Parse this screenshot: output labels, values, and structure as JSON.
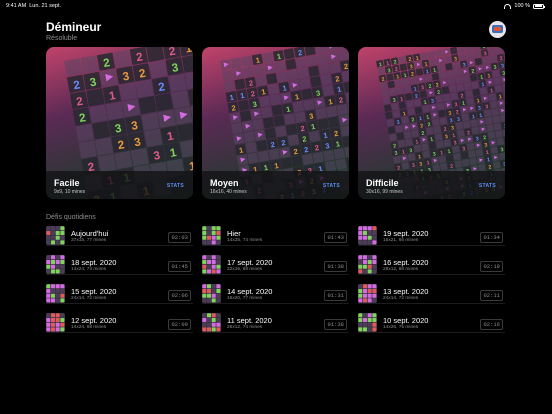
{
  "status": {
    "time": "9:41 AM",
    "date": "Lun. 21 sept.",
    "battery": "100 %"
  },
  "header": {
    "title": "Démineur",
    "subtitle": "Résoluble"
  },
  "icons": {
    "wifi": "wifi-icon",
    "battery": "battery-icon",
    "avatar": "profile-avatar"
  },
  "colors": {
    "accent": "#5b8ef2",
    "background": "#000000",
    "secondary_text": "#8e8e93"
  },
  "cards": [
    {
      "name": "Facile",
      "info": "9x9, 10 mines",
      "stats": "STATS"
    },
    {
      "name": "Moyen",
      "info": "16x16, 40 mines",
      "stats": "STATS"
    },
    {
      "name": "Difficile",
      "info": "30x16, 99 mines",
      "stats": "STATS"
    }
  ],
  "daily": {
    "title": "Défis quotidiens",
    "items": [
      {
        "name": "Aujourd'hui",
        "info": "37x15, 77 mines",
        "time": "02:03"
      },
      {
        "name": "Hier",
        "info": "14x25, 74 mines",
        "time": "01:43"
      },
      {
        "name": "19 sept. 2020",
        "info": "16x21, 66 mines",
        "time": "01:34"
      },
      {
        "name": "18 sept. 2020",
        "info": "14x24, 74 mines",
        "time": "01:45"
      },
      {
        "name": "17 sept. 2020",
        "info": "22x16, 68 mines",
        "time": "01:38"
      },
      {
        "name": "16 sept. 2020",
        "info": "28x12, 68 mines",
        "time": "02:19"
      },
      {
        "name": "15 sept. 2020",
        "info": "24x14, 72 mines",
        "time": "02:06"
      },
      {
        "name": "14 sept. 2020",
        "info": "16x20, 77 mines",
        "time": "01:31"
      },
      {
        "name": "13 sept. 2020",
        "info": "24x14, 72 mines",
        "time": "02:11"
      },
      {
        "name": "12 sept. 2020",
        "info": "14x24, 68 mines",
        "time": "02:09"
      },
      {
        "name": "11 sept. 2020",
        "info": "26x12, 74 mines",
        "time": "01:38"
      },
      {
        "name": "10 sept. 2020",
        "info": "14x26, 75 mines",
        "time": "02:16"
      }
    ]
  }
}
